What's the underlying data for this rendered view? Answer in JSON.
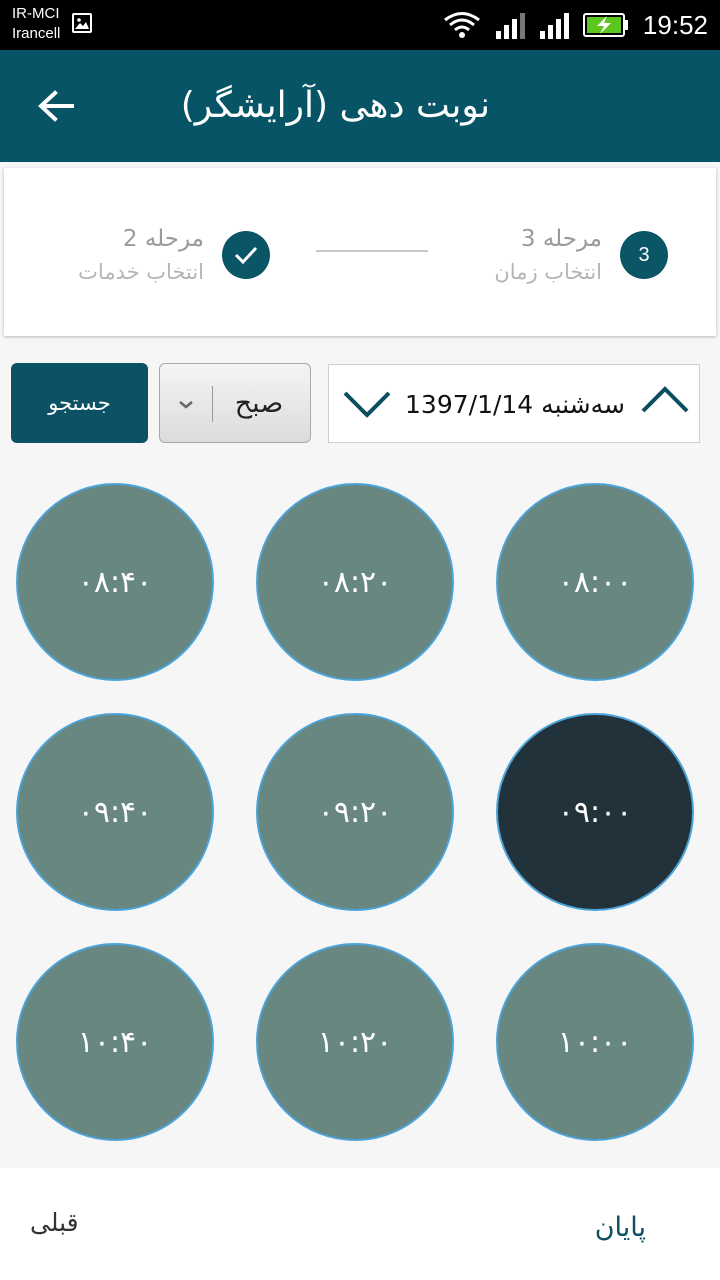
{
  "status_bar": {
    "carrier_1": "IR-MCI",
    "carrier_2": "Irancell",
    "time": "19:52",
    "icons": [
      "image-icon",
      "wifi-icon",
      "signal-icon",
      "signal-icon",
      "battery-charging-icon"
    ]
  },
  "app_bar": {
    "title": "نوبت دهی (آرایشگر)",
    "back_icon": "arrow-back-icon"
  },
  "stepper": {
    "step2": {
      "label": "مرحله 2",
      "sub": "انتخاب خدمات",
      "state": "completed"
    },
    "step3": {
      "number": "3",
      "label": "مرحله 3",
      "sub": "انتخاب زمان",
      "state": "active"
    }
  },
  "filters": {
    "date": "سه‌شنبه 1397/1/14",
    "period": "صبح",
    "search_label": "جستجو"
  },
  "time_slots": [
    {
      "time": "۰۸:۰۰",
      "selected": false
    },
    {
      "time": "۰۸:۲۰",
      "selected": false
    },
    {
      "time": "۰۸:۴۰",
      "selected": false
    },
    {
      "time": "۰۹:۰۰",
      "selected": true
    },
    {
      "time": "۰۹:۲۰",
      "selected": false
    },
    {
      "time": "۰۹:۴۰",
      "selected": false
    },
    {
      "time": "۱۰:۰۰",
      "selected": false
    },
    {
      "time": "۱۰:۲۰",
      "selected": false
    },
    {
      "time": "۱۰:۴۰",
      "selected": false
    }
  ],
  "bottom_bar": {
    "prev_label": "قبلی",
    "finish_label": "پایان"
  },
  "colors": {
    "primary": "#075466",
    "slot": "#678780",
    "slot_selected": "#22323a",
    "slot_border": "#4aa3d9"
  }
}
